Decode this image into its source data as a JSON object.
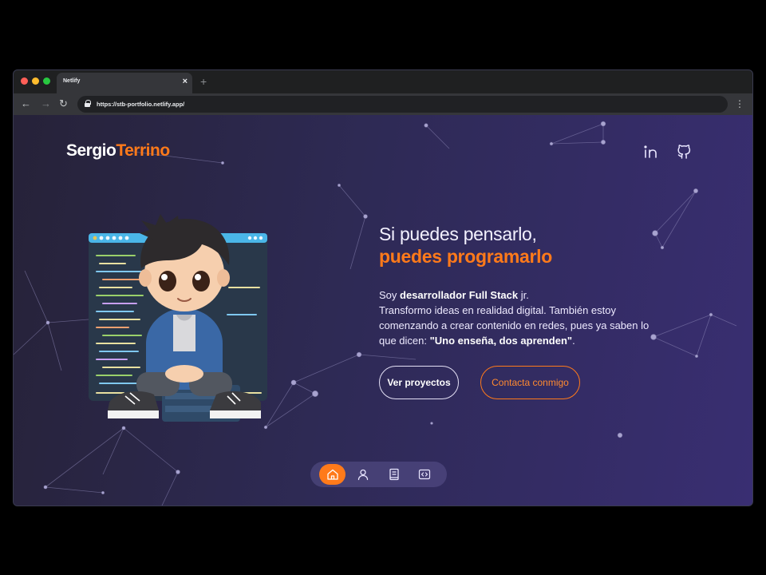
{
  "browser": {
    "tab_title": "Netlify",
    "close_glyph": "×",
    "newtab_glyph": "+",
    "url": "https://stb-portfolio.netlify.app/",
    "back_glyph": "←",
    "forward_glyph": "→",
    "reload_glyph": "↻",
    "menu_glyph": "⋮"
  },
  "header": {
    "logo_first": "Sergio",
    "logo_second": "Terrino",
    "social_icons": [
      "linkedin-icon",
      "github-icon"
    ]
  },
  "hero": {
    "title_line1": "Si puedes pensarlo,",
    "title_line2": "puedes programarlo",
    "intro_prefix": "Soy ",
    "intro_role": "desarrollador Full Stack",
    "intro_role_suffix": " jr.",
    "intro_body": "Transformo ideas en realidad digital. También estoy comenzando a crear contenido en redes, pues ya saben lo que dicen: ",
    "intro_quote": "\"Uno enseña, dos aprenden\"",
    "intro_end": ".",
    "primary_button": "Ver proyectos",
    "secondary_button": "Contacta conmigo"
  },
  "dock": {
    "items": [
      "home-icon",
      "user-icon",
      "book-icon",
      "code-icon"
    ],
    "active_index": 0
  },
  "colors": {
    "accent": "#ff7a1a",
    "background_start": "#262238",
    "background_end": "#392e72"
  }
}
